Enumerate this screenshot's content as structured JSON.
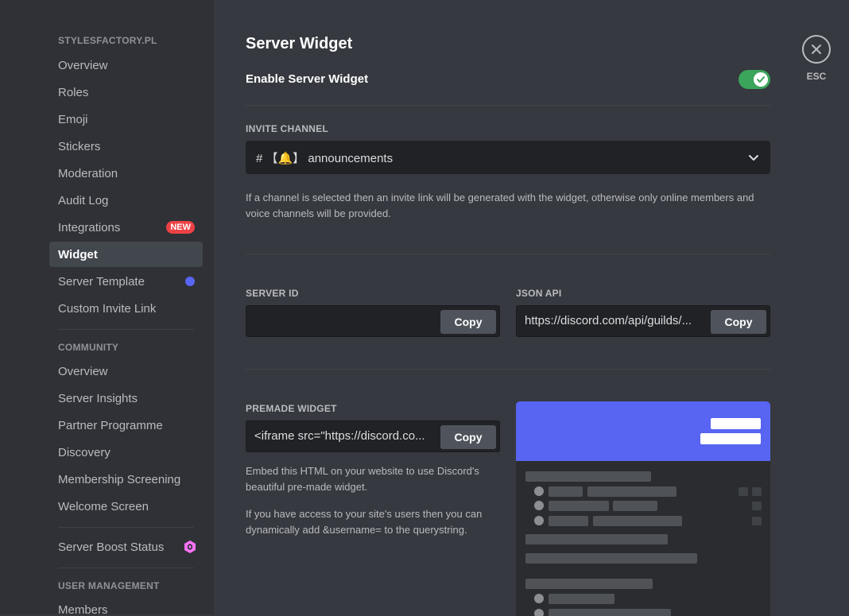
{
  "sidebar": {
    "server_header": "STYLESFACTORY.PL",
    "server_items": [
      {
        "label": "Overview"
      },
      {
        "label": "Roles"
      },
      {
        "label": "Emoji"
      },
      {
        "label": "Stickers"
      },
      {
        "label": "Moderation"
      },
      {
        "label": "Audit Log"
      },
      {
        "label": "Integrations",
        "badge": "NEW"
      },
      {
        "label": "Widget",
        "active": true
      },
      {
        "label": "Server Template"
      },
      {
        "label": "Custom Invite Link"
      }
    ],
    "community_header": "COMMUNITY",
    "community_items": [
      {
        "label": "Overview"
      },
      {
        "label": "Server Insights"
      },
      {
        "label": "Partner Programme"
      },
      {
        "label": "Discovery"
      },
      {
        "label": "Membership Screening"
      },
      {
        "label": "Welcome Screen"
      }
    ],
    "boost_item": {
      "label": "Server Boost Status"
    },
    "user_mgmt_header": "USER MANAGEMENT",
    "user_mgmt_items": [
      {
        "label": "Members"
      }
    ]
  },
  "main": {
    "title": "Server Widget",
    "enable_label": "Enable Server Widget",
    "enable_toggle_on": true,
    "invite_channel_label": "INVITE CHANNEL",
    "invite_channel_value": "# 【🔔】 announcements",
    "invite_help": "If a channel is selected then an invite link will be generated with the widget, otherwise only online members and voice channels will be provided.",
    "server_id_label": "SERVER ID",
    "server_id_value": "",
    "json_api_label": "JSON API",
    "json_api_value": "https://discord.com/api/guilds/...",
    "premade_label": "PREMADE WIDGET",
    "premade_value": "<iframe src=\"https://discord.co...",
    "copy_label": "Copy",
    "premade_help_1": "Embed this HTML on your website to use Discord's beautiful pre-made widget.",
    "premade_help_2": "If you have access to your site's users then you can dynamically add &username= to the querystring."
  },
  "close": {
    "label": "ESC"
  },
  "colors": {
    "accent": "#5865f2",
    "toggle_on": "#3ba55c",
    "badge_new": "#ed4245",
    "boost": "#ff73fa"
  },
  "icons": {
    "close": "close-icon",
    "chevron": "chevron-down-icon",
    "check": "check-icon",
    "boost": "boost-gem-icon"
  }
}
